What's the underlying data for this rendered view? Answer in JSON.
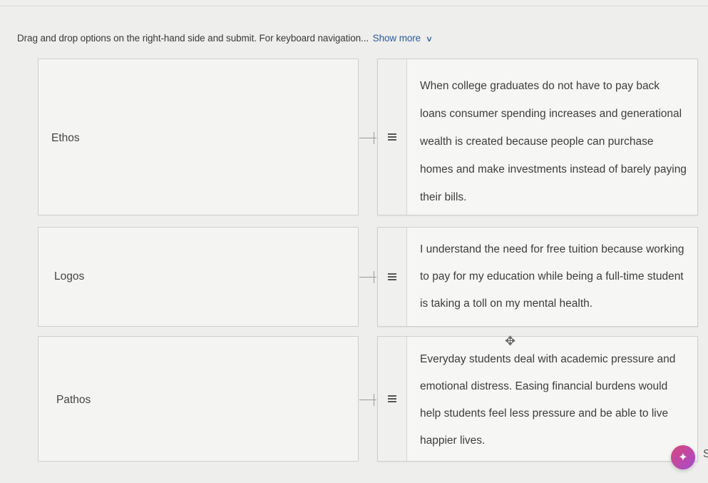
{
  "instructions": {
    "text": "Drag and drop options on the right-hand side and submit. For keyboard navigation...",
    "show_more": "Show more",
    "chevron_icon": "chevron-down-icon"
  },
  "terms": [
    {
      "label": "Ethos"
    },
    {
      "label": "Logos"
    },
    {
      "label": "Pathos"
    }
  ],
  "options": [
    {
      "text": "When college graduates do not have to pay back loans consumer spending increases and generational wealth is created because people can purchase homes and make investments instead of barely paying their bills.",
      "handle_icon": "drag-handle-icon"
    },
    {
      "text": "I understand the need for free tuition because working to pay for my education while being a full-time student is taking a toll on my mental health.",
      "handle_icon": "drag-handle-icon"
    },
    {
      "text": "Everyday students deal with academic pressure and emotional distress. Easing financial burdens would help students feel less pressure and be able to live happier lives.",
      "handle_icon": "drag-handle-icon"
    }
  ],
  "cursor_icon": "move-cursor-icon",
  "fab_icon": "sparkle-icon",
  "edge_char": "S",
  "colors": {
    "link": "#2a5aa0",
    "fab_start": "#d8487a",
    "fab_end": "#a54ad0"
  }
}
